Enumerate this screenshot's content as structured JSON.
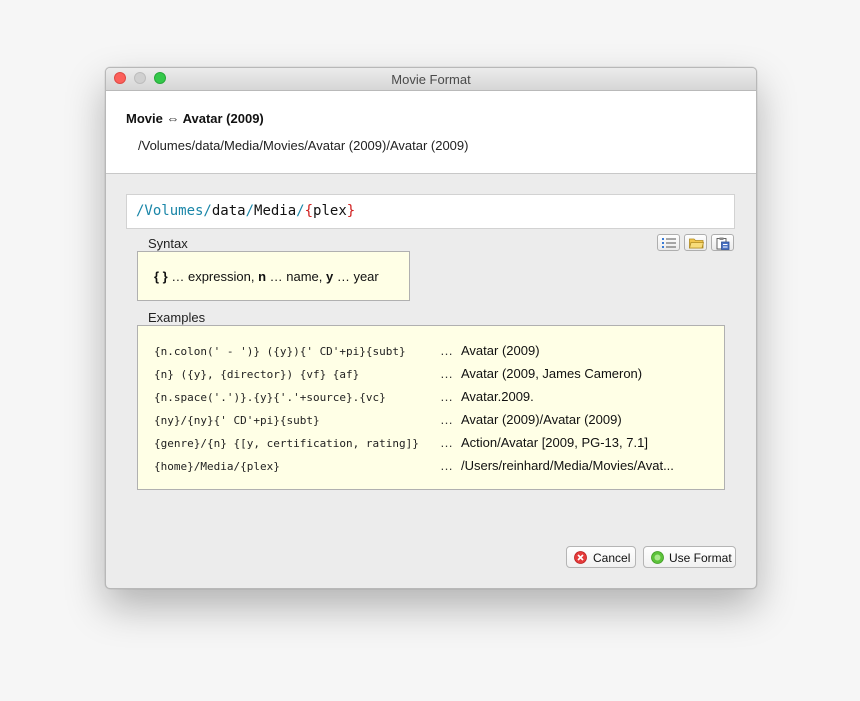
{
  "window": {
    "title": "Movie Format"
  },
  "header": {
    "title": "Movie ⇔ Avatar (2009)",
    "path": "/Volumes/data/Media/Movies/Avatar (2009)/Avatar (2009)"
  },
  "format_field": {
    "tokens": [
      {
        "text": "/Volumes/",
        "color": "#1a86a8"
      },
      {
        "text": "data",
        "color": "#111111"
      },
      {
        "text": "/",
        "color": "#1a86a8"
      },
      {
        "text": "Media",
        "color": "#111111"
      },
      {
        "text": "/",
        "color": "#1a86a8"
      },
      {
        "text": "{",
        "color": "#d01c1c"
      },
      {
        "text": "plex",
        "color": "#111111"
      },
      {
        "text": "}",
        "color": "#d01c1c"
      }
    ]
  },
  "toolbar": {
    "icons": [
      "list-icon",
      "folder-icon",
      "paste-icon"
    ]
  },
  "syntax": {
    "label": "Syntax",
    "parts": [
      {
        "text": "{ }",
        "bold": true
      },
      {
        "text": " … expression, ",
        "bold": false
      },
      {
        "text": "n",
        "bold": true
      },
      {
        "text": " … name, ",
        "bold": false
      },
      {
        "text": "y",
        "bold": true
      },
      {
        "text": " … year",
        "bold": false
      }
    ]
  },
  "examples": {
    "label": "Examples",
    "separator": "…",
    "rows": [
      {
        "code": "{n.colon(' - ')} ({y}){' CD'+pi}{subt}",
        "result": "Avatar (2009)"
      },
      {
        "code": "{n} ({y}, {director}) {vf} {af}",
        "result": "Avatar (2009, James Cameron)"
      },
      {
        "code": "{n.space('.')}.{y}{'.'+source}.{vc}",
        "result": "Avatar.2009."
      },
      {
        "code": "{ny}/{ny}{' CD'+pi}{subt}",
        "result": "Avatar (2009)/Avatar (2009)"
      },
      {
        "code": "{genre}/{n} {[y, certification, rating]}",
        "result": "Action/Avatar [2009, PG-13, 7.1]"
      },
      {
        "code": "{home}/Media/{plex}",
        "result": "/Users/reinhard/Media/Movies/Avat..."
      }
    ]
  },
  "buttons": {
    "cancel": "Cancel",
    "use_format": "Use Format"
  },
  "colors": {
    "close": "#fc605b",
    "maximize": "#34c84a",
    "cancel_icon": "#e53b3b",
    "ok_icon": "#5cc23a",
    "highlight_box": "#ffffe6"
  }
}
